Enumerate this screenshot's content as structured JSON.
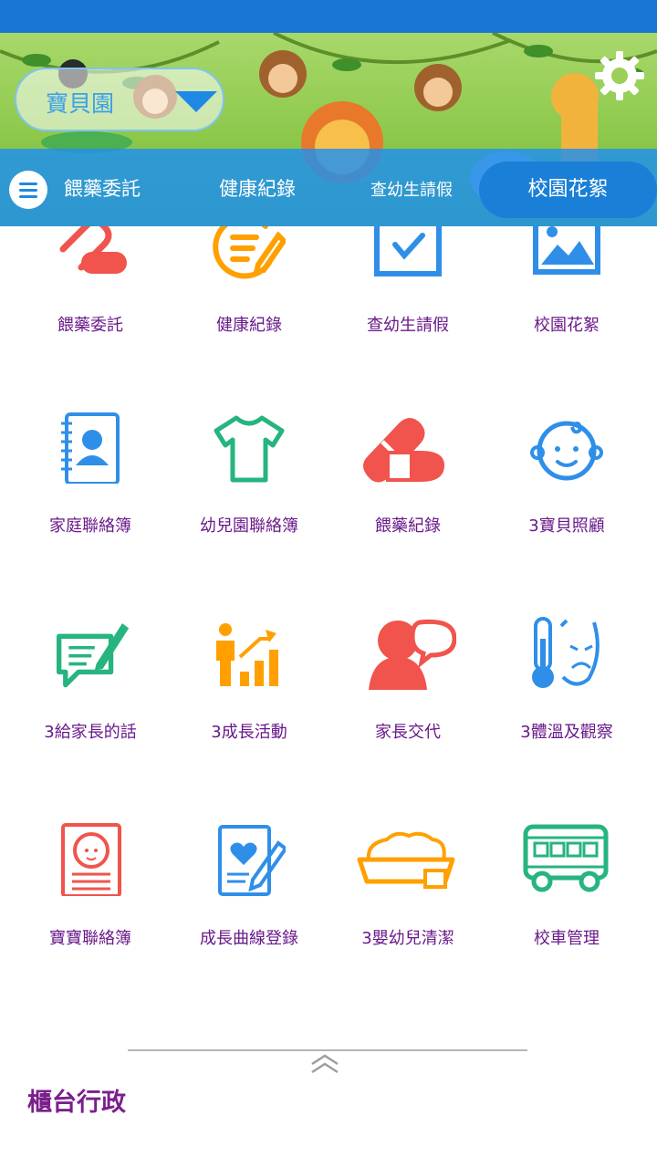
{
  "header": {
    "school_name": "寶貝園"
  },
  "tabbar": {
    "tabs": [
      {
        "label": "餵藥委託"
      },
      {
        "label": "健康紀錄"
      },
      {
        "label": "查幼生請假"
      },
      {
        "label": "校園花絮"
      }
    ],
    "active_tab": "校園花絮"
  },
  "grid": {
    "items": [
      {
        "label": "餵藥委託",
        "icon": "medicine-pill-icon",
        "color": "#f0544c"
      },
      {
        "label": "健康紀錄",
        "icon": "notes-pencil-icon",
        "color": "#ffa000"
      },
      {
        "label": "查幼生請假",
        "icon": "check-box-icon",
        "color": "#2f8fe8"
      },
      {
        "label": "校園花絮",
        "icon": "picture-icon",
        "color": "#2f8fe8"
      },
      {
        "label": "家庭聯絡簿",
        "icon": "contact-book-icon",
        "color": "#2f8fe8"
      },
      {
        "label": "幼兒園聯絡簿",
        "icon": "tshirt-icon",
        "color": "#26b47f"
      },
      {
        "label": "餵藥紀錄",
        "icon": "capsule-icon",
        "color": "#f0544c"
      },
      {
        "label": "3寶貝照顧",
        "icon": "baby-face-icon",
        "color": "#2f8fe8"
      },
      {
        "label": "3給家長的話",
        "icon": "message-pen-icon",
        "color": "#26b47f"
      },
      {
        "label": "3成長活動",
        "icon": "growth-chart-icon",
        "color": "#ffa000"
      },
      {
        "label": "家長交代",
        "icon": "person-speech-icon",
        "color": "#f0544c"
      },
      {
        "label": "3體溫及觀察",
        "icon": "thermometer-face-icon",
        "color": "#2f8fe8"
      },
      {
        "label": "寶寶聯絡簿",
        "icon": "baby-notebook-icon",
        "color": "#f0544c"
      },
      {
        "label": "成長曲線登錄",
        "icon": "heart-document-icon",
        "color": "#2f8fe8"
      },
      {
        "label": "3嬰幼兒清潔",
        "icon": "bathtub-icon",
        "color": "#ffa000"
      },
      {
        "label": "校車管理",
        "icon": "school-bus-icon",
        "color": "#26b47f"
      }
    ]
  },
  "section": {
    "title": "櫃台行政"
  }
}
